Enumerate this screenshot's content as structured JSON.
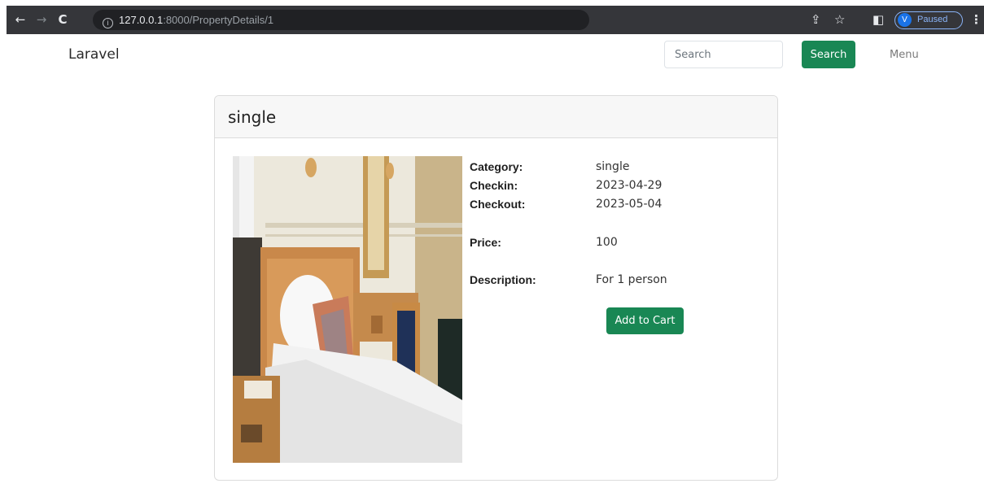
{
  "browser": {
    "url_host": "127.0.0.1",
    "url_path": ":8000/PropertyDetails/1",
    "profile_initial": "V",
    "profile_status": "Paused"
  },
  "navbar": {
    "brand": "Laravel",
    "search_placeholder": "Search",
    "search_button": "Search",
    "menu": "Menu"
  },
  "property": {
    "title": "single",
    "labels": {
      "category": "Category:",
      "checkin": "Checkin:",
      "checkout": "Checkout:",
      "price": "Price:",
      "description": "Description:"
    },
    "category": "single",
    "checkin": "2023-04-29",
    "checkout": "2023-05-04",
    "price": "100",
    "description": "For 1 person",
    "add_to_cart": "Add to Cart"
  },
  "colors": {
    "primary_button": "#198754",
    "chrome_bar": "#35363a"
  }
}
